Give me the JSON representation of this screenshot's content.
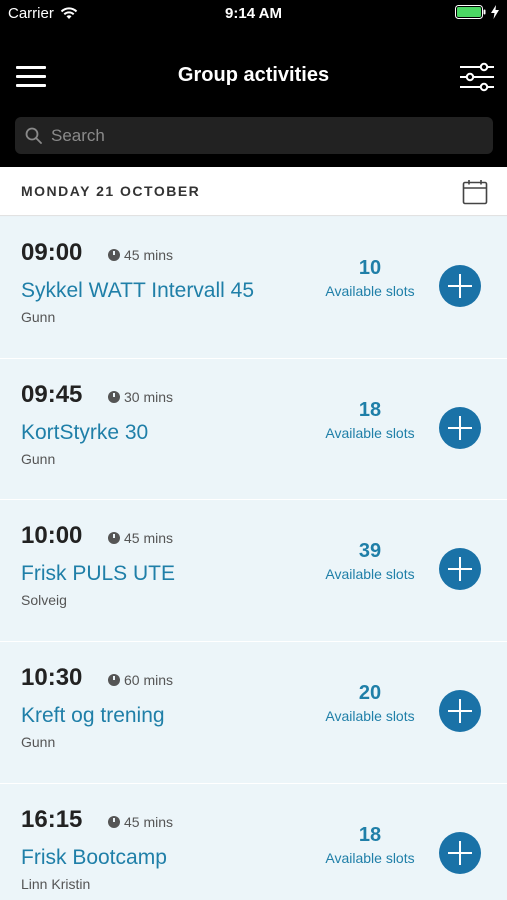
{
  "status_bar": {
    "carrier": "Carrier",
    "time": "9:14 AM"
  },
  "nav": {
    "title": "Group activities"
  },
  "search": {
    "placeholder": "Search"
  },
  "date_header": {
    "label": "MONDAY 21 OCTOBER"
  },
  "colors": {
    "accent": "#1f7fa8",
    "button": "#1a72a7",
    "row_bg": "#ecf5f9",
    "nav_bg": "#000000"
  },
  "activities": [
    {
      "time": "09:00",
      "duration": "45 mins",
      "title": "Sykkel WATT Intervall 45",
      "instructor": "Gunn",
      "slots": "10",
      "slots_label": "Available slots"
    },
    {
      "time": "09:45",
      "duration": "30 mins",
      "title": "KortStyrke 30",
      "instructor": "Gunn",
      "slots": "18",
      "slots_label": "Available slots"
    },
    {
      "time": "10:00",
      "duration": "45 mins",
      "title": "Frisk PULS UTE",
      "instructor": "Solveig",
      "slots": "39",
      "slots_label": "Available slots"
    },
    {
      "time": "10:30",
      "duration": "60 mins",
      "title": "Kreft og trening",
      "instructor": "Gunn",
      "slots": "20",
      "slots_label": "Available slots"
    },
    {
      "time": "16:15",
      "duration": "45 mins",
      "title": "Frisk Bootcamp",
      "instructor": "Linn Kristin",
      "slots": "18",
      "slots_label": "Available slots"
    }
  ]
}
